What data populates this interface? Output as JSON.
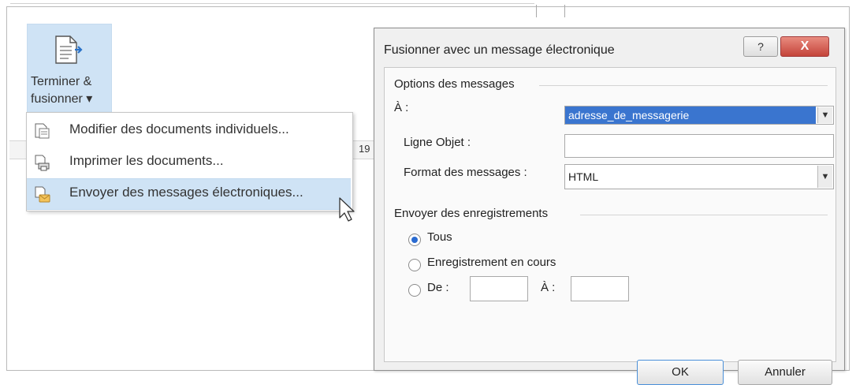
{
  "ribbon": {
    "button_label_line1": "Terminer &",
    "button_label_line2": "fusionner ▾",
    "icon": "document-arrow-icon",
    "ruler_number": "19"
  },
  "menu": {
    "items": [
      {
        "label": "Modifier des documents individuels...",
        "icon": "document-edit-icon"
      },
      {
        "label": "Imprimer les documents...",
        "icon": "printer-icon"
      },
      {
        "label": "Envoyer des messages électroniques...",
        "icon": "mail-icon"
      }
    ]
  },
  "dialog": {
    "title": "Fusionner avec un message électronique",
    "help_label": "?",
    "close_label": "X",
    "options_section": "Options des messages",
    "to_label": "À :",
    "to_value": "adresse_de_messagerie",
    "subject_label": "Ligne Objet :",
    "subject_value": "",
    "format_label": "Format des messages :",
    "format_value": "HTML",
    "send_section": "Envoyer des enregistrements",
    "radio_all": "Tous",
    "radio_current": "Enregistrement en cours",
    "radio_from": "De :",
    "range_to_label": "À :",
    "from_value": "",
    "to_range_value": "",
    "ok_label": "OK",
    "cancel_label": "Annuler",
    "selected_radio": "Tous"
  },
  "colors": {
    "highlight": "#cfe3f5",
    "selection": "#3a75cf",
    "close_red": "#c4443a"
  }
}
